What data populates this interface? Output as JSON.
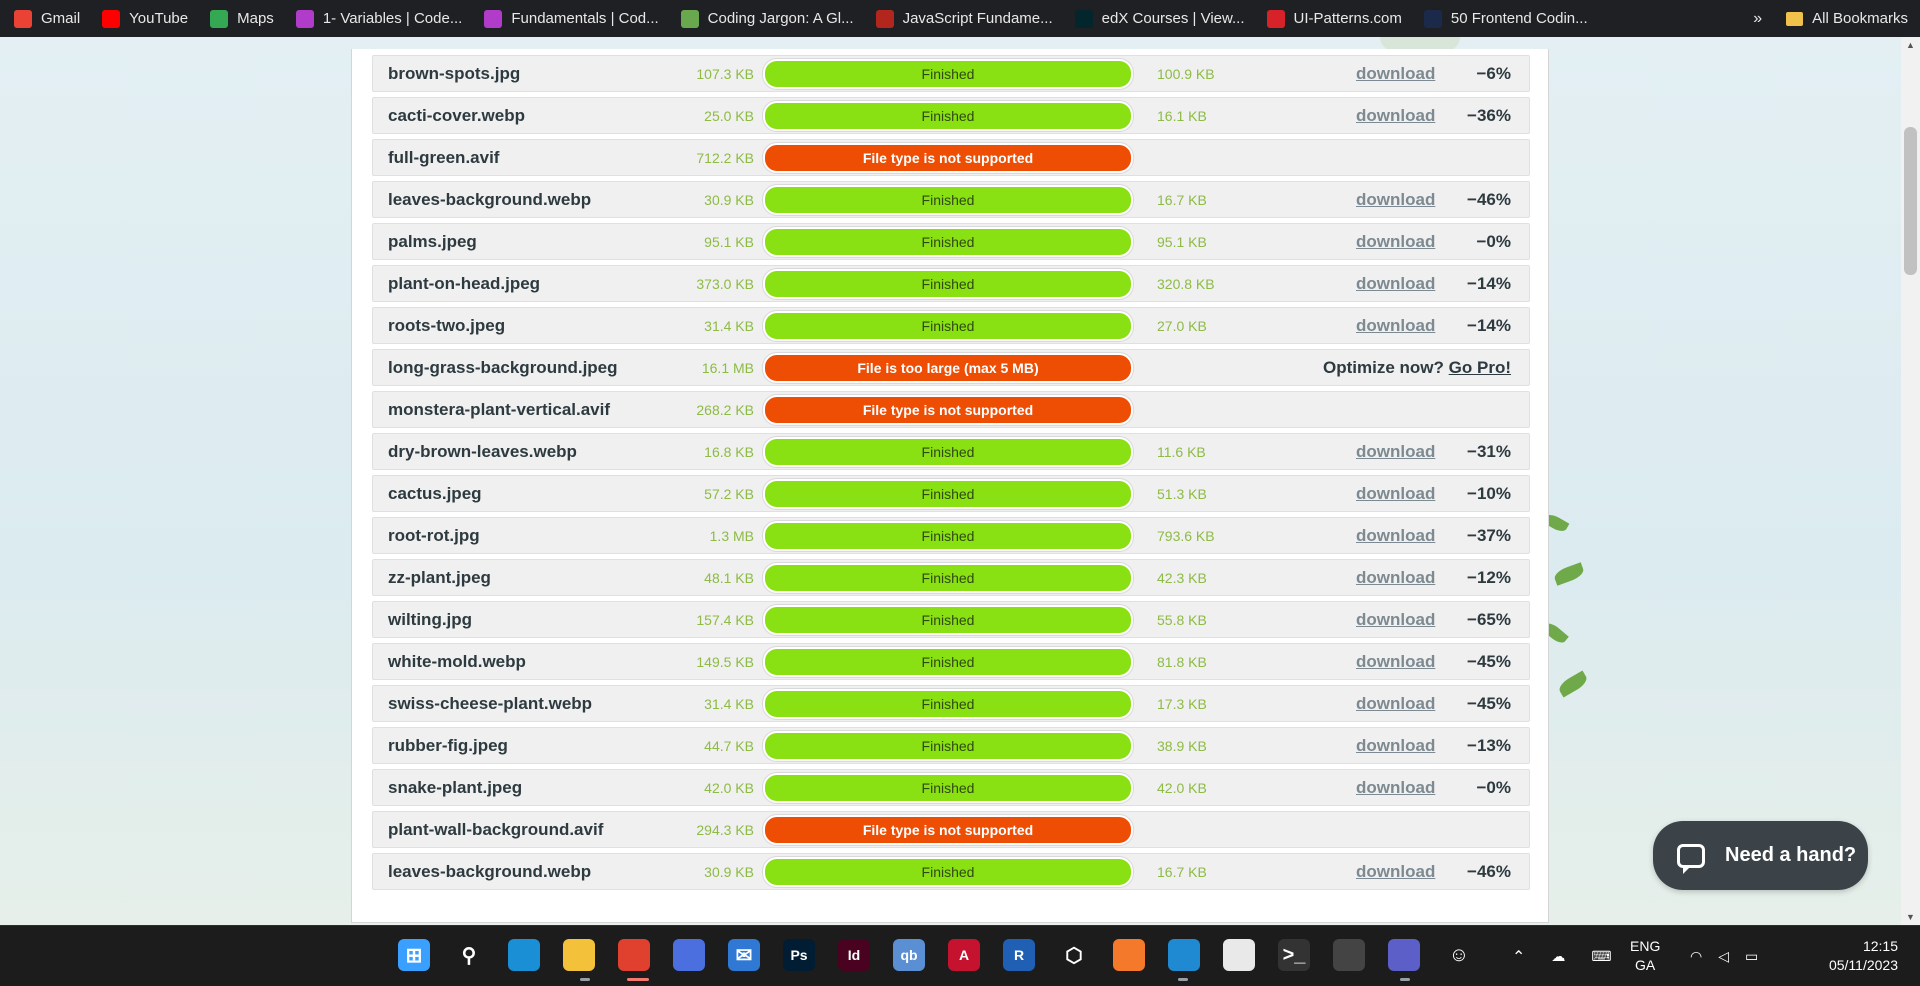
{
  "bookmarks": [
    {
      "label": "Gmail",
      "icon": "gmail-icon",
      "color": "#ea4335"
    },
    {
      "label": "YouTube",
      "icon": "youtube-icon",
      "color": "#ff0000"
    },
    {
      "label": "Maps",
      "icon": "maps-icon",
      "color": "#34a853"
    },
    {
      "label": "1- Variables | Code...",
      "icon": "codecademy-icon",
      "color": "#b13cc9"
    },
    {
      "label": "Fundamentals | Cod...",
      "icon": "codecademy-icon",
      "color": "#b13cc9"
    },
    {
      "label": "Coding Jargon: A Gl...",
      "icon": "page-icon",
      "color": "#6aa84f"
    },
    {
      "label": "JavaScript Fundame...",
      "icon": "bookmark-icon",
      "color": "#b3261e"
    },
    {
      "label": "edX Courses | View...",
      "icon": "edx-icon",
      "color": "#02262b"
    },
    {
      "label": "UI-Patterns.com",
      "icon": "ui-patterns-icon",
      "color": "#d8222a"
    },
    {
      "label": "50 Frontend Codin...",
      "icon": "frontend-icon",
      "color": "#1b2a4a"
    }
  ],
  "bookmarks_overflow": "»",
  "all_bookmarks": "All Bookmarks",
  "files": [
    {
      "name": "brown-spots.jpg",
      "size": "107.3 KB",
      "status": "Finished",
      "ok": true,
      "new_size": "100.9 KB",
      "download": "download",
      "saving": "−6%"
    },
    {
      "name": "cacti-cover.webp",
      "size": "25.0 KB",
      "status": "Finished",
      "ok": true,
      "new_size": "16.1 KB",
      "download": "download",
      "saving": "−36%"
    },
    {
      "name": "full-green.avif",
      "size": "712.2 KB",
      "status": "File type is not supported",
      "ok": false
    },
    {
      "name": "leaves-background.webp",
      "size": "30.9 KB",
      "status": "Finished",
      "ok": true,
      "new_size": "16.7 KB",
      "download": "download",
      "saving": "−46%"
    },
    {
      "name": "palms.jpeg",
      "size": "95.1 KB",
      "status": "Finished",
      "ok": true,
      "new_size": "95.1 KB",
      "download": "download",
      "saving": "−0%"
    },
    {
      "name": "plant-on-head.jpeg",
      "size": "373.0 KB",
      "status": "Finished",
      "ok": true,
      "new_size": "320.8 KB",
      "download": "download",
      "saving": "−14%"
    },
    {
      "name": "roots-two.jpeg",
      "size": "31.4 KB",
      "status": "Finished",
      "ok": true,
      "new_size": "27.0 KB",
      "download": "download",
      "saving": "−14%"
    },
    {
      "name": "long-grass-background.jpeg",
      "size": "16.1 MB",
      "status": "File is too large (max 5 MB)",
      "ok": false,
      "promo_text": "Optimize now?",
      "promo_link": "Go Pro!"
    },
    {
      "name": "monstera-plant-vertical.avif",
      "size": "268.2 KB",
      "status": "File type is not supported",
      "ok": false
    },
    {
      "name": "dry-brown-leaves.webp",
      "size": "16.8 KB",
      "status": "Finished",
      "ok": true,
      "new_size": "11.6 KB",
      "download": "download",
      "saving": "−31%"
    },
    {
      "name": "cactus.jpeg",
      "size": "57.2 KB",
      "status": "Finished",
      "ok": true,
      "new_size": "51.3 KB",
      "download": "download",
      "saving": "−10%"
    },
    {
      "name": "root-rot.jpg",
      "size": "1.3 MB",
      "status": "Finished",
      "ok": true,
      "new_size": "793.6 KB",
      "download": "download",
      "saving": "−37%"
    },
    {
      "name": "zz-plant.jpeg",
      "size": "48.1 KB",
      "status": "Finished",
      "ok": true,
      "new_size": "42.3 KB",
      "download": "download",
      "saving": "−12%"
    },
    {
      "name": "wilting.jpg",
      "size": "157.4 KB",
      "status": "Finished",
      "ok": true,
      "new_size": "55.8 KB",
      "download": "download",
      "saving": "−65%"
    },
    {
      "name": "white-mold.webp",
      "size": "149.5 KB",
      "status": "Finished",
      "ok": true,
      "new_size": "81.8 KB",
      "download": "download",
      "saving": "−45%"
    },
    {
      "name": "swiss-cheese-plant.webp",
      "size": "31.4 KB",
      "status": "Finished",
      "ok": true,
      "new_size": "17.3 KB",
      "download": "download",
      "saving": "−45%"
    },
    {
      "name": "rubber-fig.jpeg",
      "size": "44.7 KB",
      "status": "Finished",
      "ok": true,
      "new_size": "38.9 KB",
      "download": "download",
      "saving": "−13%"
    },
    {
      "name": "snake-plant.jpeg",
      "size": "42.0 KB",
      "status": "Finished",
      "ok": true,
      "new_size": "42.0 KB",
      "download": "download",
      "saving": "−0%"
    },
    {
      "name": "plant-wall-background.avif",
      "size": "294.3 KB",
      "status": "File type is not supported",
      "ok": false
    },
    {
      "name": "leaves-background.webp",
      "size": "30.9 KB",
      "status": "Finished",
      "ok": true,
      "new_size": "16.7 KB",
      "download": "download",
      "saving": "−46%"
    }
  ],
  "colors": {
    "finished": "#89e013",
    "error": "#ee4d04",
    "size_text": "#8dbb45"
  },
  "help_button": "Need a hand?",
  "taskbar": {
    "apps": [
      "windows-start-icon",
      "search-icon",
      "edge-icon",
      "file-explorer-icon",
      "chrome-icon",
      "copilot-icon",
      "mail-icon",
      "photoshop-icon",
      "indesign-icon",
      "qbittorrent-icon",
      "autocad-icon",
      "revit-icon",
      "3d-viewer-icon",
      "firefox-icon",
      "vscode-icon",
      "notepad-icon",
      "terminal-icon",
      "nvidia-icon",
      "teams-icon",
      "emoji-icon"
    ],
    "app_labels": {
      "photoshop": "Ps",
      "indesign": "Id",
      "qbittorrent": "qb",
      "autocad": "A",
      "revit": "R"
    },
    "language": "ENG",
    "language_sub": "GA",
    "time": "12:15",
    "date": "05/11/2023"
  }
}
